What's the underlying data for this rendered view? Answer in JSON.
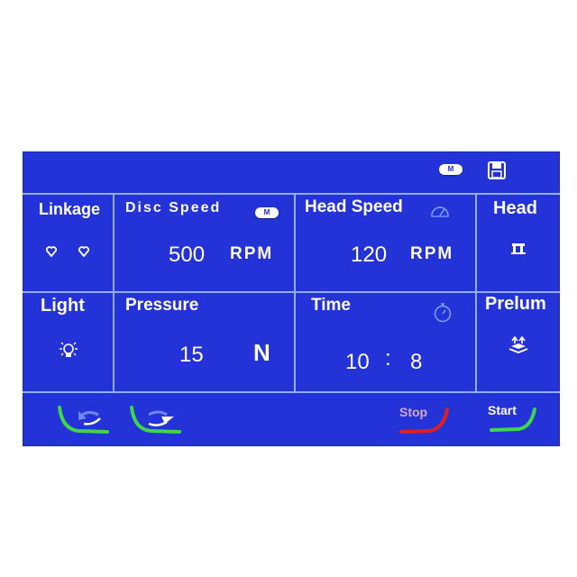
{
  "topbar": {
    "mode_badge": "M",
    "save_icon": "save-icon"
  },
  "cells": {
    "linkage": {
      "title": "Linkage",
      "icon": "heart-pair-icon"
    },
    "disc_speed": {
      "title": "Disc Speed",
      "badge": "M",
      "value": "500",
      "unit": "RPM"
    },
    "head_speed": {
      "title": "Head Speed",
      "icon": "gauge-icon",
      "value": "120",
      "unit": "RPM"
    },
    "head": {
      "title": "Head",
      "icon": "head-icon"
    },
    "light": {
      "title": "Light",
      "icon": "lightbulb-icon"
    },
    "pressure": {
      "title": "Pressure",
      "value": "15",
      "unit": "N"
    },
    "time": {
      "title": "Time",
      "icon": "stopwatch-icon",
      "minutes": "10",
      "separator": ":",
      "seconds": "8"
    },
    "prelum": {
      "title": "Prelum",
      "icon": "prelum-icon"
    }
  },
  "bottom": {
    "back_button": {
      "icon": "rotate-left-icon"
    },
    "forward_button": {
      "icon": "rotate-right-icon"
    },
    "stop_button": {
      "label": "Stop"
    },
    "start_button": {
      "label": "Start"
    }
  },
  "colors": {
    "screen_bg": "#2433d8",
    "grid": "#8fb0f5",
    "green_accent": "#3fd64a",
    "red_accent": "#e02020",
    "stop_label": "#d8a8c8"
  }
}
